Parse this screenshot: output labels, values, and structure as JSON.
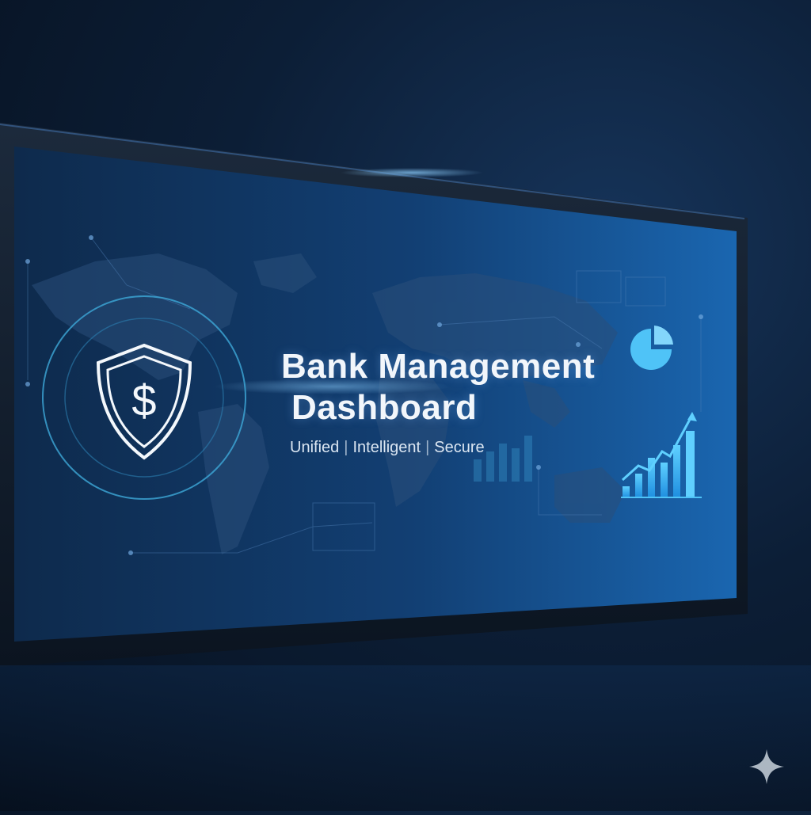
{
  "hero": {
    "title_line1": "Bank Management",
    "title_line2": "Dashboard",
    "tagline": [
      "Unified",
      "Intelligent",
      "Secure"
    ],
    "tagline_separator": "|"
  },
  "icons": {
    "security": "shield-dollar-icon",
    "pie": "pie-chart-icon",
    "growth": "bar-growth-chart-icon",
    "watermark": "sparkle-icon"
  },
  "colors": {
    "background": "#0a1a2e",
    "screen": "#123a6a",
    "accent": "#4fc3f7",
    "text": "#f2f6fb"
  }
}
